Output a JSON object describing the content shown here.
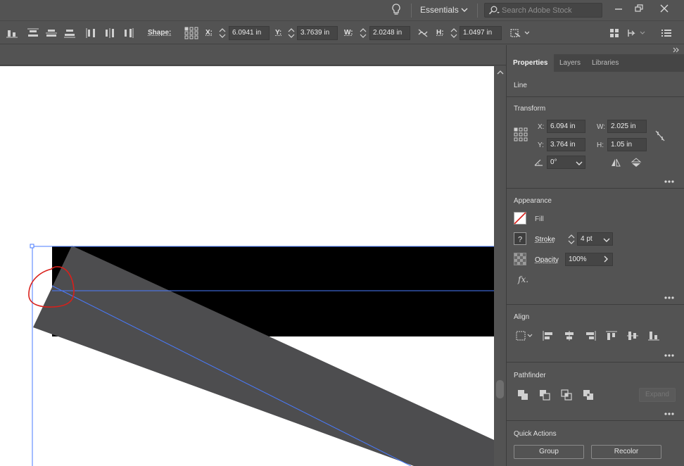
{
  "appbar": {
    "workspace": "Essentials",
    "search_placeholder": "Search Adobe Stock"
  },
  "control_bar": {
    "shape_label": "Shape:",
    "x_label": "X:",
    "x_value": "6.0941 in",
    "y_label": "Y:",
    "y_value": "3.7639 in",
    "w_label": "W:",
    "w_value": "2.0248 in",
    "h_label": "H:",
    "h_value": "1.0497 in"
  },
  "panel": {
    "tabs": [
      {
        "label": "Properties"
      },
      {
        "label": "Layers"
      },
      {
        "label": "Libraries"
      }
    ],
    "object_type": "Line",
    "transform": {
      "title": "Transform",
      "x_label": "X:",
      "x_value": "6.094 in",
      "y_label": "Y:",
      "y_value": "3.764 in",
      "w_label": "W:",
      "w_value": "2.025 in",
      "h_label": "H:",
      "h_value": "1.05 in",
      "angle_value": "0°"
    },
    "appearance": {
      "title": "Appearance",
      "fill_label": "Fill",
      "stroke_label": "Stroke",
      "stroke_value": "4 pt",
      "opacity_label": "Opacity",
      "opacity_value": "100%",
      "fx_label": "fx."
    },
    "align": {
      "title": "Align"
    },
    "pathfinder": {
      "title": "Pathfinder",
      "expand_label": "Expand"
    },
    "quick_actions": {
      "title": "Quick Actions",
      "group_label": "Group",
      "recolor_label": "Recolor"
    }
  },
  "colors": {
    "ui_bg": "#535353",
    "field_bg": "#454545",
    "canvas": "#ffffff",
    "black_shape": "#000000",
    "gray_shape": "#4d4d4f",
    "selection_blue": "#4a7bff",
    "annotation_red": "#d9201b"
  }
}
